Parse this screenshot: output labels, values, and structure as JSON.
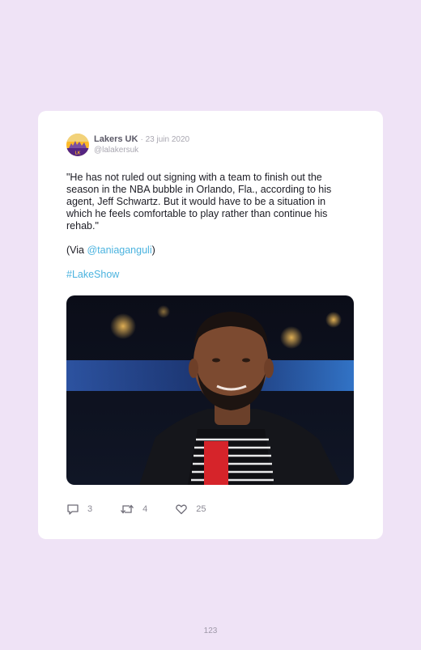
{
  "tweet": {
    "author_name": "Lakers UK",
    "date": "· 23 juin 2020",
    "handle": "@lalakersuk",
    "avatar_badge": "LK",
    "text": "\"He has not ruled out signing with a team to finish out the\nseason in the NBA bubble in Orlando, Fla., according to his\nagent, Jeff Schwartz. But it would have to be a situation in\nwhich he feels comfortable to play rather than continue his\nrehab.\"",
    "via_prefix": "(Via ",
    "via_mention": "@taniaganguli",
    "via_suffix": ")",
    "hashtag": "#LakeShow",
    "photo_icon": "player-photo",
    "replies": "3",
    "retweets": "4",
    "likes": "25"
  },
  "colors": {
    "page_background": "#efe3f6",
    "card": "#ffffff",
    "link": "#4bb3df",
    "lakers_purple": "#552583",
    "lakers_gold": "#fdb927"
  },
  "page_number": "123"
}
